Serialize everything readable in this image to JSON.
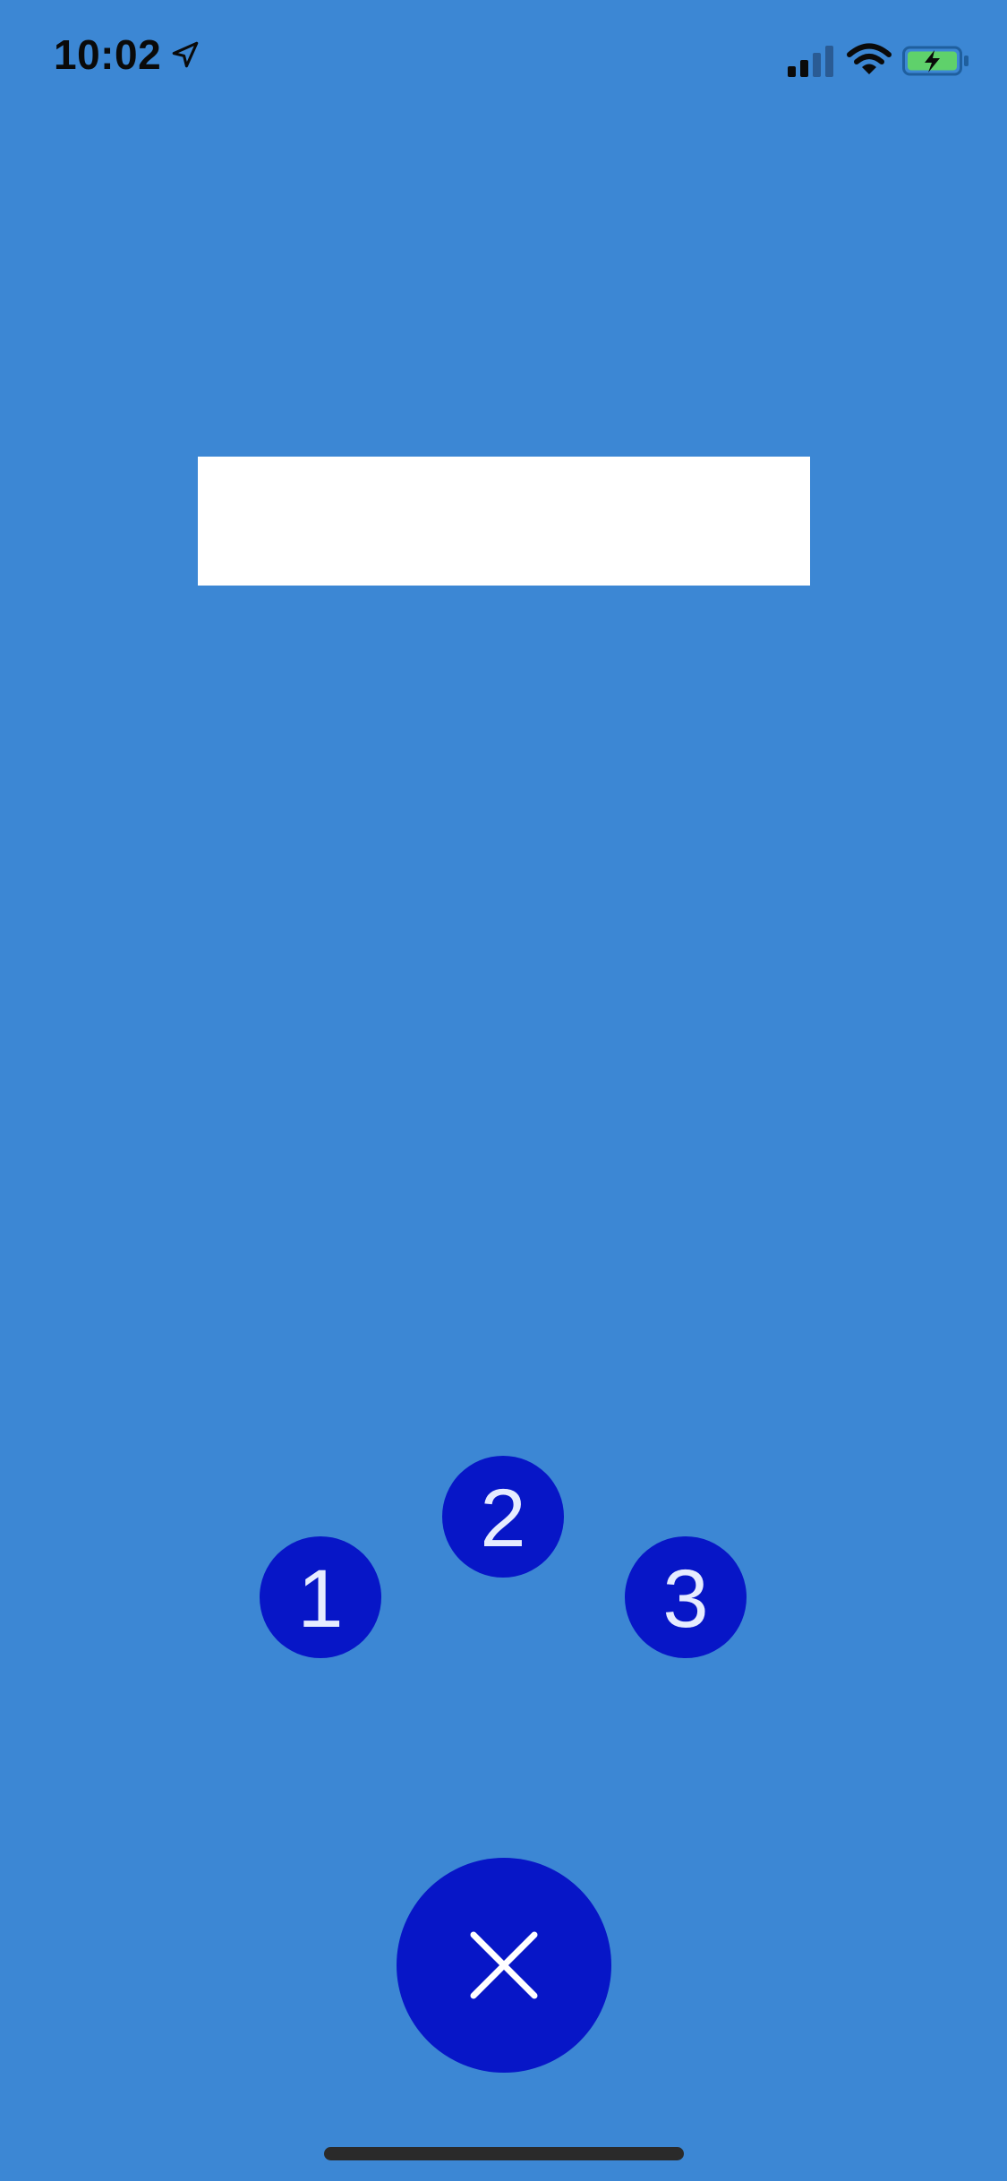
{
  "status_bar": {
    "time": "10:02",
    "icons": [
      "location-arrow-icon",
      "cellular-signal-icon",
      "wifi-icon",
      "battery-charging-icon"
    ]
  },
  "banner": {
    "text": ""
  },
  "buttons": {
    "one": "1",
    "two": "2",
    "three": "3",
    "close_icon": "close-icon"
  },
  "colors": {
    "background": "#3c87d4",
    "button": "#0716c7",
    "button_text": "#e6ecff",
    "banner": "#ffffff",
    "battery_fill": "#5fd16b"
  }
}
